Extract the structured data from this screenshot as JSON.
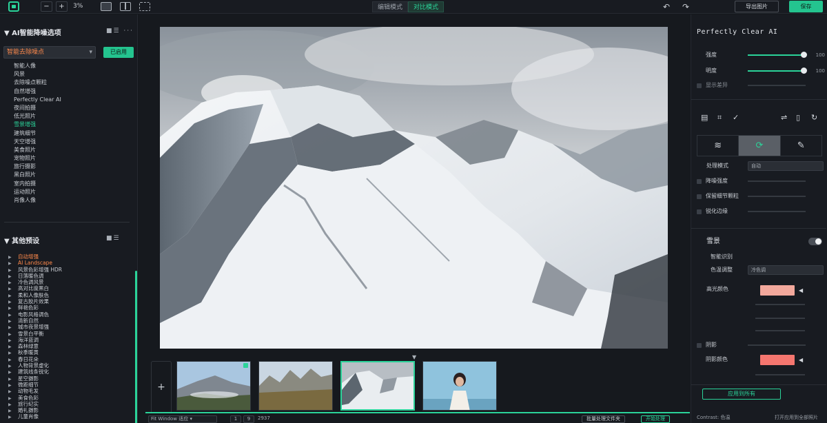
{
  "toolbar": {
    "zoom_out": "−",
    "zoom_in": "+",
    "zoom": "3%",
    "tabs": [
      {
        "label": "编辑模式",
        "active": false
      },
      {
        "label": "对比模式",
        "active": true
      }
    ],
    "undo": "↶",
    "redo": "↷",
    "export_label": "导出图片",
    "save_label": "保存"
  },
  "left_panel": {
    "section1_title": "AI智能降噪选项",
    "section1_icons": "■☰ ···",
    "dropdown_value": "智能去除噪点",
    "dropdown_chevron": "▾",
    "apply_button": "已启用",
    "options": [
      {
        "label": "智能人像",
        "highlight": false
      },
      {
        "label": "风景",
        "highlight": false
      },
      {
        "label": "去除噪点颗粒",
        "highlight": false
      },
      {
        "label": "自然增强",
        "highlight": false
      },
      {
        "label": "Perfectly Clear AI",
        "highlight": false
      },
      {
        "label": "夜间拍摄",
        "highlight": false
      },
      {
        "label": "低光照片",
        "highlight": false
      },
      {
        "label": "雪景增强",
        "highlight": true
      },
      {
        "label": "建筑细节",
        "highlight": false
      },
      {
        "label": "天空增强",
        "highlight": false
      },
      {
        "label": "美食照片",
        "highlight": false
      },
      {
        "label": "宠物照片",
        "highlight": false
      },
      {
        "label": "旅行摄影",
        "highlight": false
      },
      {
        "label": "黑白照片",
        "highlight": false
      },
      {
        "label": "室内拍摄",
        "highlight": false
      },
      {
        "label": "运动照片",
        "highlight": false
      },
      {
        "label": "肖像人像",
        "highlight": false
      }
    ],
    "section2_title": "其他预设",
    "section2_icons": "■☰",
    "presets": [
      {
        "label": "自动增强",
        "highlight": true
      },
      {
        "label": "AI Landscape",
        "highlight": true
      },
      {
        "label": "风景色彩增强 HDR",
        "highlight": false
      },
      {
        "label": "日落暖色调",
        "highlight": false
      },
      {
        "label": "冷色调风景",
        "highlight": false
      },
      {
        "label": "高对比度黑白",
        "highlight": false
      },
      {
        "label": "柔和人像肤色",
        "highlight": false
      },
      {
        "label": "复古胶片效果",
        "highlight": false
      },
      {
        "label": "鲜艳色彩",
        "highlight": false
      },
      {
        "label": "电影风格调色",
        "highlight": false
      },
      {
        "label": "清新自然",
        "highlight": false
      },
      {
        "label": "城市夜景增强",
        "highlight": false
      },
      {
        "label": "雪景白平衡",
        "highlight": false
      },
      {
        "label": "海洋蓝调",
        "highlight": false
      },
      {
        "label": "森林绿意",
        "highlight": false
      },
      {
        "label": "秋季暖黄",
        "highlight": false
      },
      {
        "label": "春日花朵",
        "highlight": false
      },
      {
        "label": "人物背景虚化",
        "highlight": false
      },
      {
        "label": "建筑线条锐化",
        "highlight": false
      },
      {
        "label": "星空摄影",
        "highlight": false
      },
      {
        "label": "微距细节",
        "highlight": false
      },
      {
        "label": "动物毛发",
        "highlight": false
      },
      {
        "label": "美食色彩",
        "highlight": false
      },
      {
        "label": "旅行纪实",
        "highlight": false
      },
      {
        "label": "婚礼摄影",
        "highlight": false
      },
      {
        "label": "儿童肖像",
        "highlight": false
      }
    ],
    "tree_arrow": "▶"
  },
  "center": {
    "add_label": "+",
    "caret": "▼",
    "filmstrip_progress": 1.0,
    "bottom": {
      "view_select": "Fit Window 适应 ▾",
      "page_a": "1",
      "page_b": "9",
      "page_sep": "2937",
      "batch_button": "批量处理文件夹",
      "process_button": "开始处理"
    }
  },
  "right_panel": {
    "title": "Perfectly Clear AI",
    "sliders": [
      {
        "label": "强度",
        "value": "100",
        "fraction": 0.96
      },
      {
        "label": "明度",
        "value": "100",
        "fraction": 0.96
      }
    ],
    "faint_row": "显示差异",
    "tab_icons": [
      "≋",
      "⟳",
      "✎"
    ],
    "rows2": [
      {
        "label": "处理模式",
        "select": "自动",
        "type": "select"
      },
      {
        "label": "降噪强度",
        "type": "check"
      },
      {
        "label": "保留细节颗粒",
        "type": "check"
      },
      {
        "label": "锐化边缘",
        "type": "check"
      }
    ],
    "section_label": "雪景",
    "toggle_on": true,
    "sub_rows": [
      {
        "label": "智能识别"
      },
      {
        "label": "色温调整",
        "select": "冷色调"
      }
    ],
    "tint_label": "高光颜色",
    "swatch1": "#f2a89c",
    "swatch2": "#f5766f",
    "shadow_label": "阴影",
    "shadow_tint_label": "阴影颜色",
    "swatch_arrow": "◀",
    "reset_button": "应用到所有",
    "footer_left": "Contrast: 色温",
    "footer_right": "打开应用到全部照片"
  }
}
